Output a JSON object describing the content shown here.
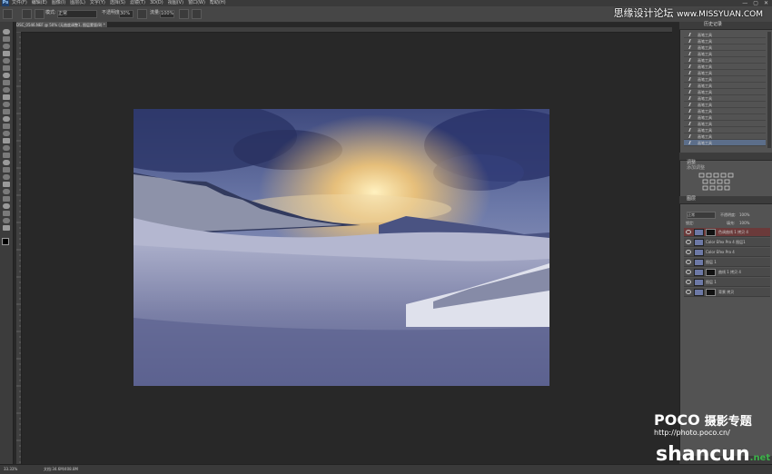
{
  "app": {
    "logo_text": "Ps"
  },
  "menu": [
    "文件(F)",
    "编辑(E)",
    "图像(I)",
    "图层(L)",
    "文字(Y)",
    "选择(S)",
    "滤镜(T)",
    "3D(D)",
    "视图(V)",
    "窗口(W)",
    "帮助(H)"
  ],
  "window_controls": [
    "—",
    "▢",
    "✕"
  ],
  "options": {
    "mode_label": "模式:",
    "mode_value": "正常",
    "opacity_label": "不透明度:",
    "opacity_value": "30%",
    "flow_label": "流量:",
    "flow_value": "100%"
  },
  "document_tab": "DSC_0546.NEF @ 50% (无曲度调整1, 图层蒙版/8) *",
  "history_label": "历史记录",
  "history_items": [
    "画笔工具",
    "画笔工具",
    "画笔工具",
    "画笔工具",
    "画笔工具",
    "画笔工具",
    "画笔工具",
    "画笔工具",
    "画笔工具",
    "画笔工具",
    "画笔工具",
    "画笔工具",
    "画笔工具",
    "画笔工具",
    "画笔工具",
    "画笔工具",
    "画笔工具",
    "画笔工具"
  ],
  "adjustments_label": "调整",
  "adjustments_add": "添加调整",
  "layers": {
    "tab_label": "图层",
    "blend_mode": "正常",
    "opacity_label": "不透明度:",
    "opacity_value": "100%",
    "fill_label": "填充:",
    "fill_value": "100%",
    "lock_label": "锁定:",
    "items": [
      {
        "name": "色调曲线 1 拷贝 4",
        "has_mask": true,
        "selected": true
      },
      {
        "name": "Color Efex Pro 4 图层1",
        "has_mask": false,
        "selected": false
      },
      {
        "name": "Color Efex Pro 4",
        "has_mask": false,
        "selected": false
      },
      {
        "name": "图层 1",
        "has_mask": false,
        "selected": false
      },
      {
        "name": "曲线 1 拷贝 4",
        "has_mask": true,
        "selected": false
      },
      {
        "name": "图层 1",
        "has_mask": false,
        "selected": false
      },
      {
        "name": "背景 拷贝",
        "has_mask": true,
        "selected": false
      }
    ]
  },
  "status": {
    "zoom": "33.33%",
    "doc_size": "文档:34.6M/408.8M"
  },
  "watermarks": {
    "top_cn": "思缘设计论坛",
    "top_url": "www.MISSYUAN.COM",
    "poco_logo": "POCO",
    "poco_cn": "摄影专题",
    "poco_url": "http://photo.poco.cn/",
    "shancun": "shancun",
    "shancun_net": ".net"
  },
  "icons": [
    "brush-icon",
    "move-icon",
    "marquee-icon",
    "lasso-icon",
    "crop-icon",
    "eyedropper-icon",
    "heal-icon",
    "stamp-icon",
    "eraser-icon",
    "gradient-icon",
    "pen-icon",
    "type-icon",
    "hand-icon",
    "zoom-icon",
    "eye-icon"
  ]
}
